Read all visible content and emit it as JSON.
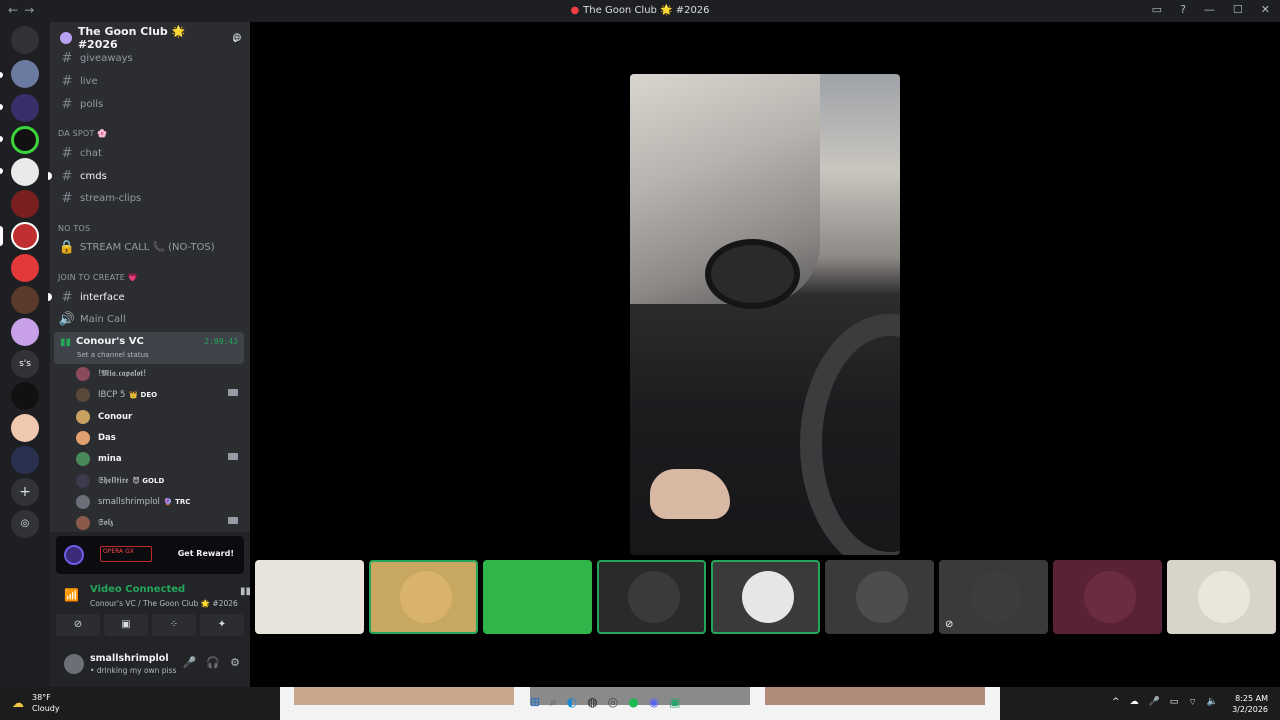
{
  "window": {
    "title": "The Goon Club 🌟 #2026",
    "nav_back": "←",
    "nav_forward": "→",
    "controls": [
      "▭",
      "?",
      "—",
      "☐",
      "✕"
    ]
  },
  "server": {
    "name": "The Goon Club 🌟 #2026",
    "dropdown_icon": "⌄",
    "add_member_icon": "person-add-icon"
  },
  "channels": [
    {
      "name": "giveaways",
      "type": "text",
      "prefix": "#",
      "bold": false
    },
    {
      "name": "live",
      "type": "text",
      "prefix": "#",
      "bold": false
    },
    {
      "name": "polls",
      "type": "text",
      "prefix": "#",
      "bold": false
    }
  ],
  "categories": {
    "da_spot": "DA SPOT 🌸",
    "no_tos": "NO TOS",
    "join_to_create": "JOIN TO CREATE 💗"
  },
  "da_spot_channels": [
    {
      "name": "chat",
      "bold": false
    },
    {
      "name": "cmds",
      "bold": true
    },
    {
      "name": "stream-clips",
      "bold": false
    }
  ],
  "no_tos_channel": "STREAM CALL 📞 (NO-TOS)",
  "join_channels": {
    "interface": "interface",
    "main_call": "Main Call"
  },
  "voice_channel": {
    "name": "Conour's VC",
    "status": "Set a channel status",
    "duration": "2:09:43"
  },
  "members": [
    {
      "name": "!𝕸𝖎𝖆.𝖈𝖆𝖕𝖆𝖑𝖔𝖙!",
      "tag": "",
      "bold": false,
      "camera": false,
      "color": "#8a4a5a"
    },
    {
      "name": "IBCP 5",
      "tag": "👑 DEO",
      "bold": false,
      "camera": true,
      "color": "#5a4a3a"
    },
    {
      "name": "Conour",
      "tag": "",
      "bold": true,
      "camera": false,
      "color": "#c9a060"
    },
    {
      "name": "Das",
      "tag": "",
      "bold": true,
      "camera": false,
      "color": "#e0a070"
    },
    {
      "name": "mina",
      "tag": "",
      "bold": true,
      "camera": true,
      "color": "#4a8a5a"
    },
    {
      "name": "𝕾𝖍𝖊𝖑𝖑𝖋𝖎𝖗𝖊",
      "tag": "😈 GOLD",
      "bold": false,
      "camera": false,
      "color": "#3a3a4a"
    },
    {
      "name": "smallshrimplol",
      "tag": "🔮 TRC",
      "bold": false,
      "camera": false,
      "color": "#6b6f78"
    },
    {
      "name": "𝕾𝖔𝖑𝖟",
      "tag": "",
      "bold": false,
      "camera": true,
      "color": "#8a5a4a"
    }
  ],
  "promo": {
    "brand": "OPERA GX",
    "cta": "Get Reward!"
  },
  "connection": {
    "state": "Video Connected",
    "location": "Conour's VC / The Goon Club 🌟 #2026"
  },
  "user": {
    "name": "smallshrimplol",
    "status": "• drinking my own piss"
  },
  "tiles": [
    {
      "kind": "photo",
      "color": "#e8e4dc",
      "speaking": false,
      "muted": false
    },
    {
      "kind": "avatar",
      "color": "#d9b36a",
      "speaking": true,
      "muted": false
    },
    {
      "kind": "photo",
      "color": "#2fb54a",
      "speaking": false,
      "muted": false
    },
    {
      "kind": "avatar",
      "color": "#3a3a3a",
      "speaking": true,
      "muted": false
    },
    {
      "kind": "avatar",
      "color": "#e6e6e6",
      "speaking": true,
      "muted": false
    },
    {
      "kind": "avatar",
      "color": "#4d4d4d",
      "speaking": false,
      "muted": false
    },
    {
      "kind": "avatar",
      "color": "#3c3c3c",
      "speaking": false,
      "muted": true
    },
    {
      "kind": "avatar",
      "color": "#6b2b40",
      "speaking": false,
      "muted": false
    },
    {
      "kind": "avatar",
      "color": "#e9e6dc",
      "speaking": false,
      "muted": false
    }
  ],
  "taskbar": {
    "weather_temp": "38°F",
    "weather_desc": "Cloudy",
    "time": "8:25 AM",
    "date": "3/2/2026"
  },
  "colors": {
    "accent_green": "#23a55a",
    "sidebar_bg": "#2b2d31",
    "guild_bg": "#1e1f22"
  }
}
